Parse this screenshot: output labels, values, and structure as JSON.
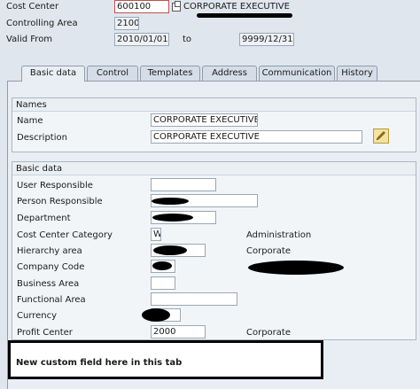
{
  "header": {
    "cost_center_label": "Cost Center",
    "cost_center_value": "600100",
    "cost_center_name": "CORPORATE EXECUTIVE",
    "controlling_area_label": "Controlling Area",
    "controlling_area_value": "2100",
    "valid_from_label": "Valid From",
    "valid_from_value": "2010/01/01",
    "to_label": "to",
    "valid_to_value": "9999/12/31"
  },
  "tabs": [
    {
      "label": "Basic data",
      "active": true
    },
    {
      "label": "Control"
    },
    {
      "label": "Templates"
    },
    {
      "label": "Address"
    },
    {
      "label": "Communication"
    },
    {
      "label": "History"
    }
  ],
  "names_group": {
    "title": "Names",
    "name_label": "Name",
    "name_value": "CORPORATE EXECUTIVE",
    "description_label": "Description",
    "description_value": "CORPORATE EXECUTIVE",
    "edit_icon": "edit-pencil-icon"
  },
  "basic_group": {
    "title": "Basic data",
    "user_responsible_label": "User Responsible",
    "user_responsible_value": "",
    "person_responsible_label": "Person Responsible",
    "department_label": "Department",
    "category_label": "Cost Center Category",
    "category_value": "W",
    "category_text": "Administration",
    "hierarchy_label": "Hierarchy area",
    "hierarchy_text": "Corporate",
    "company_code_label": "Company Code",
    "business_area_label": "Business Area",
    "business_area_value": "",
    "functional_area_label": "Functional Area",
    "functional_area_value": "",
    "currency_label": "Currency",
    "profit_center_label": "Profit Center",
    "profit_center_value": "2000",
    "profit_center_text": "Corporate"
  },
  "callout": {
    "text": "New custom field here in this tab"
  },
  "colors": {
    "background": "#dfe6ee",
    "panel": "#e8eef4",
    "field_border": "#9aa7b4",
    "callout_border": "#000000"
  }
}
